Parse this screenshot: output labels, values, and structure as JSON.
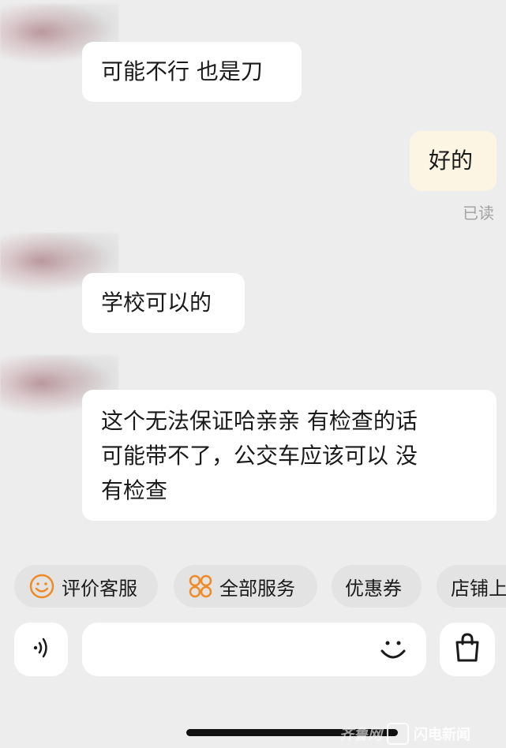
{
  "messages": [
    {
      "from": "agent",
      "text": "可能不行 也是刀"
    },
    {
      "from": "me",
      "text": "好的",
      "status": "已读"
    },
    {
      "from": "agent",
      "text": "学校可以的"
    },
    {
      "from": "agent",
      "lines": [
        "这个无法保证哈亲亲 有检查的话",
        "可能带不了，公交车应该可以 没",
        "有检查"
      ]
    }
  ],
  "quick_actions": [
    {
      "label": "评价客服",
      "icon": "smile-icon"
    },
    {
      "label": "全部服务",
      "icon": "grid-icon"
    },
    {
      "label": "优惠券"
    },
    {
      "label": "店铺上"
    }
  ],
  "input": {
    "placeholder": ""
  },
  "watermark": {
    "logo_text": "齐鲁网",
    "brand_text": "闪电新闻"
  },
  "colors": {
    "accent": "#f08a24",
    "my_bubble": "#fcf5e4",
    "background": "#ededed"
  }
}
